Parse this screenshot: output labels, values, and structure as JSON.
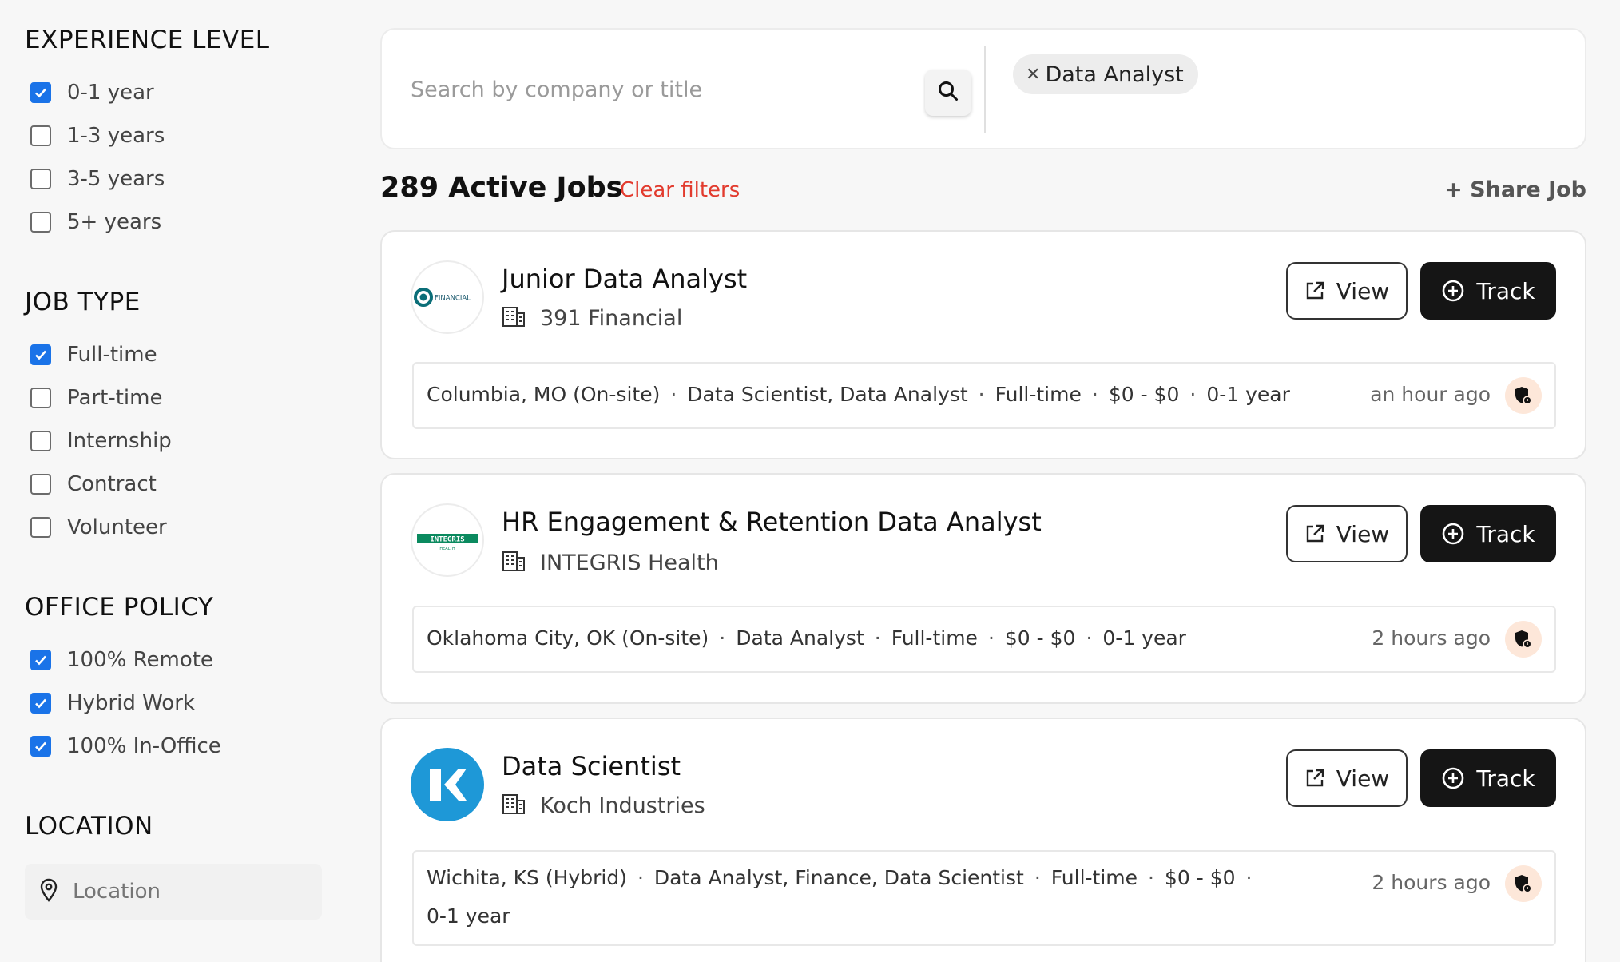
{
  "filters": {
    "experience": {
      "title": "EXPERIENCE LEVEL",
      "options": [
        {
          "label": "0-1 year",
          "checked": true
        },
        {
          "label": "1-3 years",
          "checked": false
        },
        {
          "label": "3-5 years",
          "checked": false
        },
        {
          "label": "5+ years",
          "checked": false
        }
      ]
    },
    "job_type": {
      "title": "JOB TYPE",
      "options": [
        {
          "label": "Full-time",
          "checked": true
        },
        {
          "label": "Part-time",
          "checked": false
        },
        {
          "label": "Internship",
          "checked": false
        },
        {
          "label": "Contract",
          "checked": false
        },
        {
          "label": "Volunteer",
          "checked": false
        }
      ]
    },
    "office_policy": {
      "title": "OFFICE POLICY",
      "options": [
        {
          "label": "100% Remote",
          "checked": true
        },
        {
          "label": "Hybrid Work",
          "checked": true
        },
        {
          "label": "100% In-Office",
          "checked": true
        }
      ]
    },
    "location": {
      "title": "LOCATION",
      "placeholder": "Location",
      "value": ""
    }
  },
  "search": {
    "placeholder": "Search by company or title",
    "value": "",
    "chip": "Data Analyst"
  },
  "results": {
    "count_label": "289 Active Jobs",
    "clear_label": "Clear filters",
    "share_label": "+ Share Job"
  },
  "buttons": {
    "view": "View",
    "track": "Track"
  },
  "jobs": [
    {
      "title": "Junior Data Analyst",
      "company": "391 Financial",
      "logo": "391-financial-logo",
      "logo_text": "FINANCIAL",
      "meta": [
        "Columbia, MO (On-site)",
        "Data Scientist, Data Analyst",
        "Full-time",
        "$0 - $0",
        "0-1 year"
      ],
      "posted": "an hour ago"
    },
    {
      "title": "HR Engagement & Retention Data Analyst",
      "company": "INTEGRIS Health",
      "logo": "integris-health-logo",
      "logo_text": "INTEGRIS",
      "logo_subtext": "HEALTH",
      "meta": [
        "Oklahoma City, OK (On-site)",
        "Data Analyst",
        "Full-time",
        "$0 - $0",
        "0-1 year"
      ],
      "posted": "2 hours ago"
    },
    {
      "title": "Data Scientist",
      "company": "Koch Industries",
      "logo": "koch-industries-logo",
      "meta": [
        "Wichita, KS (Hybrid)",
        "Data Analyst, Finance, Data Scientist",
        "Full-time",
        "$0 - $0"
      ],
      "meta_line2": "0-1 year",
      "posted": "2 hours ago"
    }
  ],
  "colors": {
    "accent": "#1a73e8",
    "clear": "#e23b2e",
    "track_bg": "#151515",
    "koch_blue": "#1e98d7",
    "integris_green": "#0b8a5f"
  }
}
